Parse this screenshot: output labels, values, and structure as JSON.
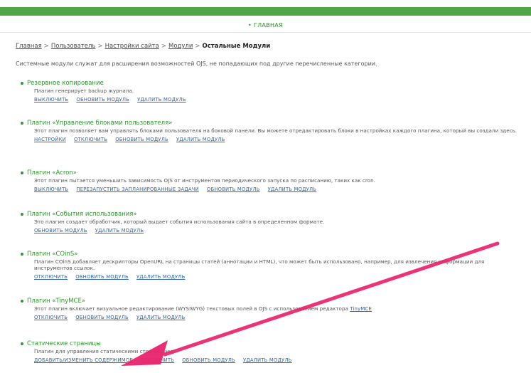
{
  "topnav": {
    "home": "ГЛАВНАЯ"
  },
  "breadcrumb": {
    "items": [
      "Главная",
      "Пользователь",
      "Настройки сайта",
      "Модули"
    ],
    "separator": ">",
    "current": "Остальные Модули"
  },
  "intro": "Системные модули служат для расширения возможностей OJS, не попадающих под другие перечисленные категории.",
  "plugins": [
    {
      "title": "Резервное копирование",
      "description": "Плагин генерирует backup журнала.",
      "actions": [
        "ВЫКЛЮЧИТЬ",
        "ОБНОВИТЬ МОДУЛЬ",
        "УДАЛИТЬ МОДУЛЬ"
      ]
    },
    {
      "title": "Плагин «Управление блоками пользователя»",
      "description": "Этот плагин позволяет вам управлять блоками пользователя на боковой панели. Вы можете отредактировать блоки в настройках каждого плагина, который вы создали здесь.",
      "actions": [
        "НАСТРОЙКИ",
        "ОТКЛЮЧИТЬ",
        "ОБНОВИТЬ МОДУЛЬ",
        "УДАЛИТЬ МОДУЛЬ"
      ]
    },
    {
      "title": "Плагин «Acron»",
      "description": "Этот плагин пытается уменьшить зависимость OJS от инструментов периодического запуска по расписанию, таких как cron.",
      "actions": [
        "ВЫКЛЮЧИТЬ",
        "ПЕРЕЗАПУСТИТЬ ЗАПЛАНИРОВАННЫЕ ЗАДАЧИ",
        "ОБНОВИТЬ МОДУЛЬ",
        "УДАЛИТЬ МОДУЛЬ"
      ]
    },
    {
      "title": "Плагин «События использования»",
      "description": "Это плагин создает обработчик, который выдает события использования сайта в определенном формате.",
      "actions": [
        "ОБНОВИТЬ МОДУЛЬ",
        "УДАЛИТЬ МОДУЛЬ"
      ]
    },
    {
      "title": "Плагин «COinS»",
      "description": "Плагин COinS добавляет дескрипторы OpenURL на страницы статей (аннотации и HTML), что может быть использовано, например, для извлечения информации для инструментов ссылок.",
      "actions": [
        "ОТКЛЮЧИТЬ",
        "ОБНОВИТЬ МОДУЛЬ",
        "УДАЛИТЬ МОДУЛЬ"
      ]
    },
    {
      "title": "Плагин «TinyMCE»",
      "description": "Этот плагин включает визуальное редактирование (WYSIWYG) текстовых полей в OJS с использованием редактора",
      "description_link": "TinyMCE",
      "actions": [
        "ОТКЛЮЧИТЬ",
        "ОБНОВИТЬ МОДУЛЬ",
        "УДАЛИТЬ МОДУЛЬ"
      ]
    },
    {
      "title": "Статические страницы",
      "description": "Плагин для управления статическими страницами.",
      "actions": [
        "ДОБАВИТЬ/ИЗМЕНИТЬ СОДЕРЖИМОЕ",
        "ОТКЛЮЧИТЬ",
        "ОБНОВИТЬ МОДУЛЬ",
        "УДАЛИТЬ МОДУЛЬ"
      ]
    }
  ],
  "colors": {
    "topbar": "#4fa845",
    "plugin_title": "#2f962f",
    "link": "#3366aa",
    "arrow": "#e8236e"
  }
}
